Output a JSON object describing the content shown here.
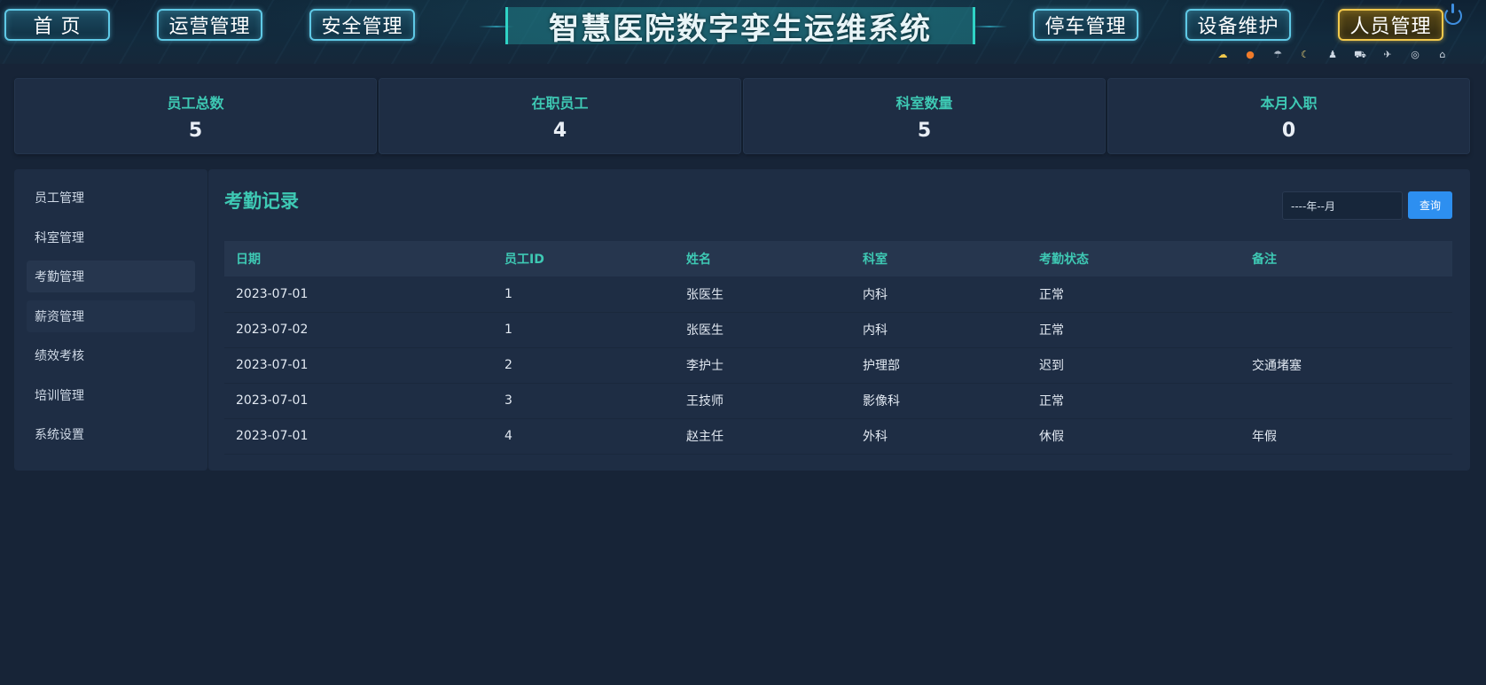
{
  "header": {
    "title": "智慧医院数字孪生运维系统",
    "nav": [
      {
        "label": "首  页"
      },
      {
        "label": "运营管理"
      },
      {
        "label": "安全管理"
      },
      {
        "label": "停车管理"
      },
      {
        "label": "设备维护"
      },
      {
        "label": "人员管理",
        "active": true
      }
    ],
    "weather_icons": [
      "cloud-sun-icon",
      "sun-icon",
      "rain-icon",
      "moon-icon",
      "person-icon",
      "car-icon",
      "plane-icon",
      "camera-360-icon",
      "home-icon"
    ]
  },
  "stats": [
    {
      "label": "员工总数",
      "value": "5"
    },
    {
      "label": "在职员工",
      "value": "4"
    },
    {
      "label": "科室数量",
      "value": "5"
    },
    {
      "label": "本月入职",
      "value": "0"
    }
  ],
  "sidebar": {
    "items": [
      {
        "label": "员工管理"
      },
      {
        "label": "科室管理"
      },
      {
        "label": "考勤管理",
        "active": true
      },
      {
        "label": "薪资管理"
      },
      {
        "label": "绩效考核"
      },
      {
        "label": "培训管理"
      },
      {
        "label": "系统设置"
      }
    ]
  },
  "main": {
    "title": "考勤记录",
    "month_placeholder": "----年--月",
    "query_label": "查询",
    "columns": [
      "日期",
      "员工ID",
      "姓名",
      "科室",
      "考勤状态",
      "备注"
    ],
    "rows": [
      [
        "2023-07-01",
        "1",
        "张医生",
        "内科",
        "正常",
        ""
      ],
      [
        "2023-07-02",
        "1",
        "张医生",
        "内科",
        "正常",
        ""
      ],
      [
        "2023-07-01",
        "2",
        "李护士",
        "护理部",
        "迟到",
        "交通堵塞"
      ],
      [
        "2023-07-01",
        "3",
        "王技师",
        "影像科",
        "正常",
        ""
      ],
      [
        "2023-07-01",
        "4",
        "赵主任",
        "外科",
        "休假",
        "年假"
      ]
    ]
  },
  "colors": {
    "accent": "#3ec9b4",
    "primary_button": "#2d8ff0",
    "background": "#172437",
    "panel": "#1e2d44"
  }
}
